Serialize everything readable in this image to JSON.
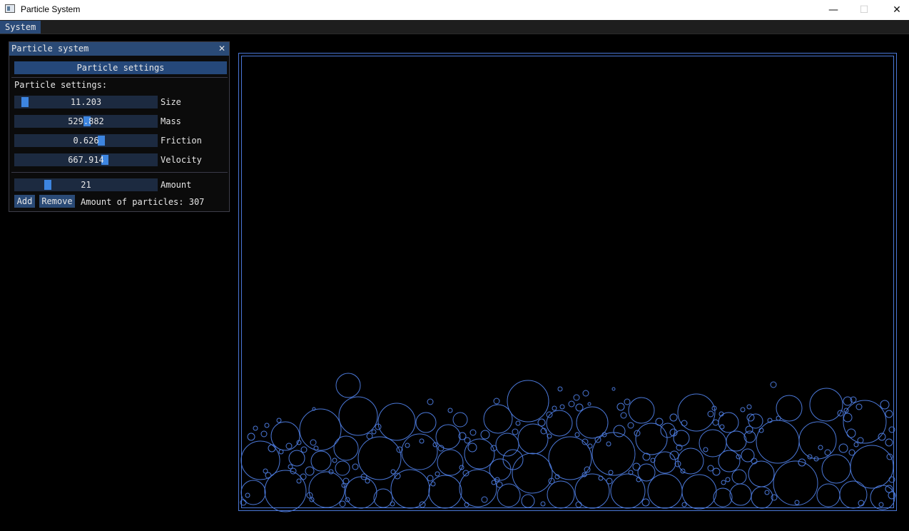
{
  "window": {
    "title": "Particle System",
    "controls": {
      "minimize": "—",
      "maximize": "☐",
      "close": "✕"
    }
  },
  "menubar": {
    "items": [
      "System"
    ]
  },
  "panel": {
    "title": "Particle system",
    "close_glyph": "✕",
    "header": "Particle settings",
    "section_label": "Particle settings:",
    "sliders": [
      {
        "label": "Size",
        "value": "11.203",
        "fraction": 0.05
      },
      {
        "label": "Mass",
        "value": "529.882",
        "fraction": 0.51
      },
      {
        "label": "Friction",
        "value": "0.626",
        "fraction": 0.615
      },
      {
        "label": "Velocity",
        "value": "667.914",
        "fraction": 0.64
      }
    ],
    "amount": {
      "label": "Amount",
      "value": "21",
      "fraction": 0.22
    },
    "buttons": {
      "add": "Add",
      "remove": "Remove"
    },
    "particle_count_text": "Amount of particles: 307"
  },
  "accent_colors": {
    "panel_header": "#2a4a76",
    "slider_grab": "#3d85e0",
    "particle_outline": "#4b78d8"
  }
}
